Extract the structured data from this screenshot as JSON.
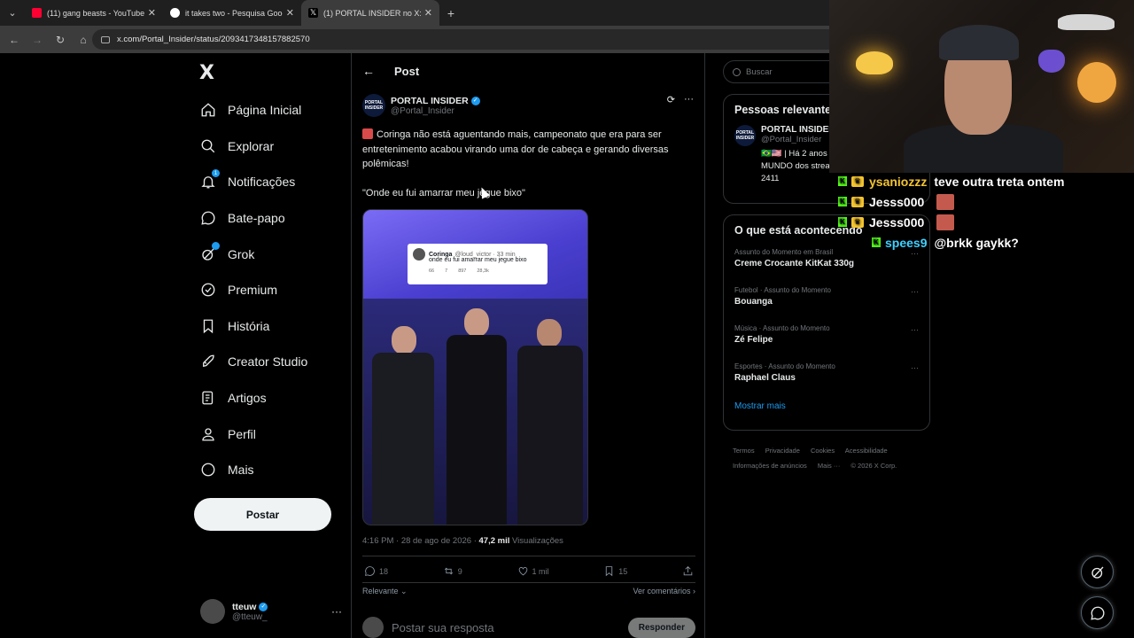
{
  "browser": {
    "tabs": [
      {
        "title": "(11) gang beasts - YouTube",
        "favicon_color": "#ff0033",
        "active": false
      },
      {
        "title": "it takes two - Pesquisa Google",
        "favicon_color": "#ffffff",
        "active": false
      },
      {
        "title": "(1) PORTAL INSIDER no X: \"",
        "favicon_color": "#ffffff",
        "active": true
      }
    ],
    "url": "x.com/Portal_Insider/status/2093417348157882570"
  },
  "sidebar": {
    "logo": "X",
    "items": [
      {
        "label": "Página Inicial",
        "icon": "home-icon"
      },
      {
        "label": "Explorar",
        "icon": "search-icon"
      },
      {
        "label": "Notificações",
        "icon": "bell-icon",
        "badge": "1"
      },
      {
        "label": "Bate-papo",
        "icon": "chat-icon"
      },
      {
        "label": "Grok",
        "icon": "grok-icon"
      },
      {
        "label": "Premium",
        "icon": "verified-icon"
      },
      {
        "label": "História",
        "icon": "bookmark-icon"
      },
      {
        "label": "Creator Studio",
        "icon": "rocket-icon"
      },
      {
        "label": "Artigos",
        "icon": "article-icon"
      },
      {
        "label": "Perfil",
        "icon": "person-icon"
      },
      {
        "label": "Mais",
        "icon": "more-circle-icon"
      }
    ],
    "post_button": "Postar",
    "account": {
      "name": "tteuw",
      "handle": "@tteuw_"
    }
  },
  "post": {
    "header": "Post",
    "author": {
      "name": "PORTAL INSIDER",
      "handle": "@Portal_Insider",
      "logo_text": "PORTAL INSIDER"
    },
    "text_1": "Coringa não está aguentando mais, campeonato que era para ser entretenimento acabou virando uma dor de cabeça e gerando diversas polêmicas!",
    "text_2": "\"Onde eu fui amarrar meu jegue bixo\"",
    "quoted": {
      "name": "Coringa",
      "handle": "@loud_victor · 33 min",
      "text": "onde eu fui amarrar meu jegue bixo",
      "replies": "66",
      "reposts": "7",
      "likes": "897",
      "views": "28,3k"
    },
    "meta_time": "4:16 PM · 28 de ago de 2026 ·",
    "meta_views": "47,2 mil",
    "meta_views_label": "Visualizações",
    "stats": {
      "replies": "18",
      "reposts": "9",
      "likes": "1 mil",
      "bookmarks": "15"
    },
    "sort_label": "Relevante",
    "see_comments": "Ver comentários",
    "reply_placeholder": "Postar sua resposta",
    "reply_button": "Responder"
  },
  "right": {
    "search_placeholder": "Buscar",
    "relevant": {
      "title": "Pessoas relevantes",
      "name": "PORTAL INSIDER",
      "handle": "@Portal_Insider",
      "bio_1": "🇧🇷🇺🇸 | Há 2 anos",
      "bio_2": "MUNDO dos stream",
      "bio_3": "2411"
    },
    "trending_title": "O que está acontecendo",
    "trends": [
      {
        "context": "Assunto do Momento em Brasil",
        "topic": "Creme Crocante KitKat 330g"
      },
      {
        "context": "Futebol · Assunto do Momento",
        "topic": "Bouanga"
      },
      {
        "context": "Música · Assunto do Momento",
        "topic": "Zé Felipe"
      },
      {
        "context": "Esportes · Assunto do Momento",
        "topic": "Raphael Claus"
      }
    ],
    "show_more": "Mostrar mais",
    "footer": [
      "Termos",
      "Privacidade",
      "Cookies",
      "Acessibilidade",
      "Informações de anúncios",
      "Mais ···",
      "© 2026 X Corp."
    ]
  },
  "stream_chat": [
    {
      "user": "ysaniozzz",
      "message": "teve outra treta ontem",
      "user_color": "#f4c430",
      "emote": false
    },
    {
      "user": "Jesss000",
      "message": "",
      "user_color": "#ffffff",
      "emote": true
    },
    {
      "user": "Jesss000",
      "message": "",
      "user_color": "#ffffff",
      "emote": true
    },
    {
      "user": "spees9",
      "message": "@brkk gaykk?",
      "user_color": "#3fd0ff",
      "emote": false
    }
  ],
  "colors": {
    "accent": "#1d9bf0",
    "background": "#000000",
    "border": "#2f3336",
    "kick": "#53fc18"
  }
}
